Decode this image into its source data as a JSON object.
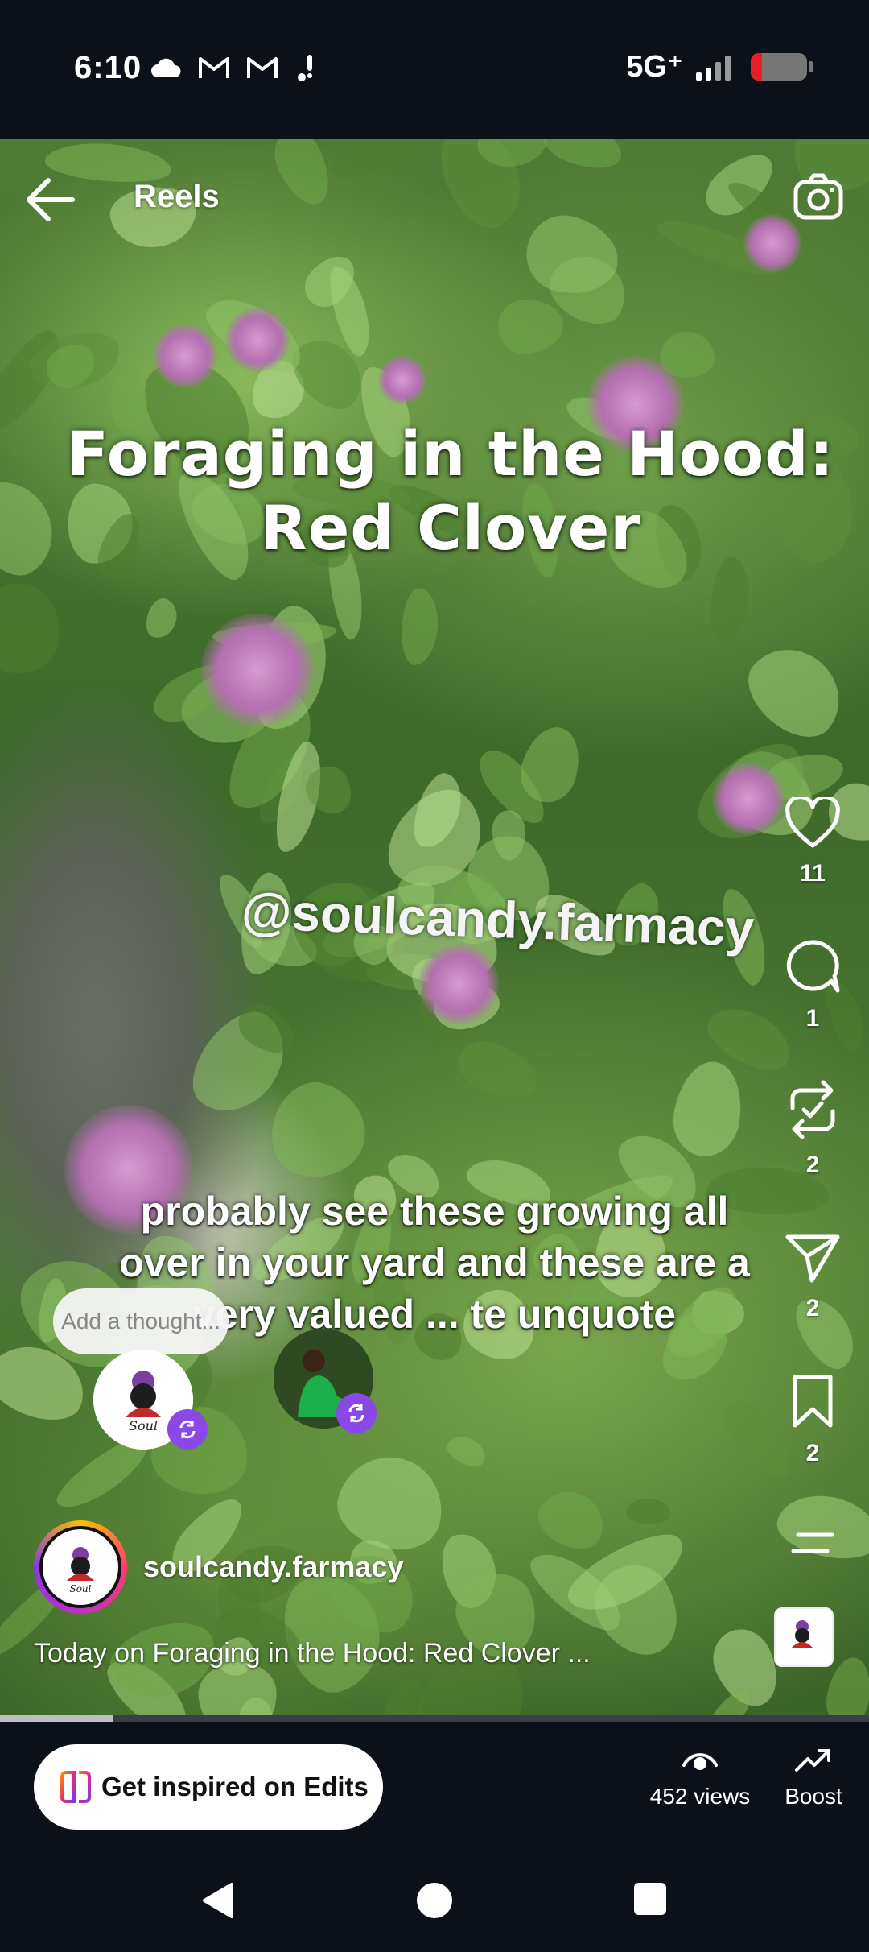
{
  "status_bar": {
    "time": "6:10",
    "network": "5G⁺",
    "battery_percent": 20,
    "battery_color": "#e62024"
  },
  "header": {
    "title": "Reels",
    "back_icon": "arrow-left-icon",
    "camera_icon": "camera-icon"
  },
  "video_overlay": {
    "title_line1": "Foraging in the Hood:",
    "title_line2": "Red Clover",
    "handle": "@soulcandy.farmacy",
    "caption": "probably see these growing all over in your yard and these are a very valued ... te unquote"
  },
  "thought_bubble": {
    "placeholder": "Add a thought..."
  },
  "actions": {
    "likes": "11",
    "comments": "1",
    "reposts": "2",
    "shares": "2",
    "saves": "2"
  },
  "post": {
    "username": "soulcandy.farmacy",
    "description": "Today on Foraging in the Hood: Red Clover ..."
  },
  "progress_fraction": 0.13,
  "bottom_bar": {
    "edits_label": "Get inspired on Edits",
    "views_label": "452 views",
    "boost_label": "Boost"
  },
  "colors": {
    "accent_purple": "#8a49e6",
    "background": "#0c1119"
  }
}
